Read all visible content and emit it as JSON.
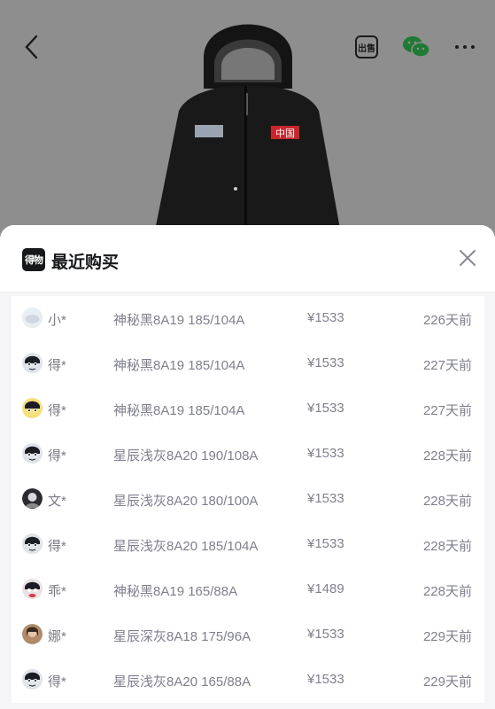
{
  "topbar": {
    "back_icon": "chevron-left-icon",
    "sell_label": "出售",
    "wechat_icon": "wechat-icon",
    "more_icon": "more-icon"
  },
  "product": {
    "badge_text": "中国"
  },
  "sheet": {
    "logo_text": "得物",
    "title": "最近购买",
    "close_icon": "close-icon"
  },
  "purchases": [
    {
      "name": "小*",
      "spec": "神秘黑8A19 185/104A",
      "price": "¥1533",
      "time": "226天前",
      "avatar": "avatar-light"
    },
    {
      "name": "得*",
      "spec": "神秘黑8A19 185/104A",
      "price": "¥1533",
      "time": "227天前",
      "avatar": "avatar-cartoon"
    },
    {
      "name": "得*",
      "spec": "神秘黑8A19 185/104A",
      "price": "¥1533",
      "time": "227天前",
      "avatar": "avatar-cartoon-yellow"
    },
    {
      "name": "得*",
      "spec": "星辰浅灰8A20 190/108A",
      "price": "¥1533",
      "time": "228天前",
      "avatar": "avatar-cartoon"
    },
    {
      "name": "文*",
      "spec": "星辰浅灰8A20 180/100A",
      "price": "¥1533",
      "time": "228天前",
      "avatar": "avatar-dark"
    },
    {
      "name": "得*",
      "spec": "星辰浅灰8A20 185/104A",
      "price": "¥1533",
      "time": "228天前",
      "avatar": "avatar-cartoon"
    },
    {
      "name": "乖*",
      "spec": "神秘黑8A19 165/88A",
      "price": "¥1489",
      "time": "228天前",
      "avatar": "avatar-cartoon-red"
    },
    {
      "name": "娜*",
      "spec": "星辰深灰8A18 175/96A",
      "price": "¥1533",
      "time": "229天前",
      "avatar": "avatar-photo"
    },
    {
      "name": "得*",
      "spec": "星辰浅灰8A20 165/88A",
      "price": "¥1533",
      "time": "229天前",
      "avatar": "avatar-cartoon"
    }
  ],
  "colors": {
    "overlay": "#8e8e8e",
    "sheet_bg": "#f5f5f7",
    "text_muted": "#7f7f8e",
    "title": "#16181a",
    "badge_red": "#c9252c"
  }
}
